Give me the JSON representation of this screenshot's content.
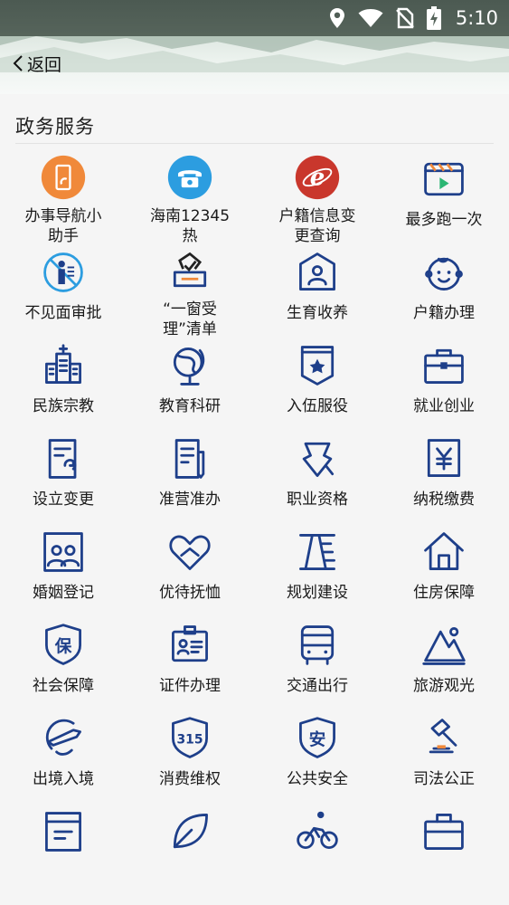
{
  "status_bar": {
    "time": "5:10",
    "icons": [
      "location-icon",
      "wifi-icon",
      "no-sim-icon",
      "battery-charging-icon"
    ]
  },
  "header": {
    "back_label": "返回"
  },
  "section": {
    "title": "政务服务"
  },
  "colors": {
    "icon_blue": "#1e3f8a",
    "orange": "#f0893a",
    "sky_blue": "#2c9de0",
    "red": "#c9372c"
  },
  "services": [
    {
      "label": "办事导航小助手",
      "icon": "phone-guide-icon"
    },
    {
      "label": "海南12345热",
      "icon": "telephone-icon"
    },
    {
      "label": "户籍信息变更查询",
      "icon": "browser-e-icon"
    },
    {
      "label": "最多跑一次",
      "icon": "video-play-icon"
    },
    {
      "label": "不见面审批",
      "icon": "no-person-icon"
    },
    {
      "label": "“一窗受理”清单",
      "icon": "ballot-box-icon"
    },
    {
      "label": "生育收养",
      "icon": "family-house-icon"
    },
    {
      "label": "户籍办理",
      "icon": "baby-face-icon"
    },
    {
      "label": "民族宗教",
      "icon": "church-icon"
    },
    {
      "label": "教育科研",
      "icon": "globe-icon"
    },
    {
      "label": "入伍服役",
      "icon": "military-badge-icon"
    },
    {
      "label": "就业创业",
      "icon": "briefcase-icon"
    },
    {
      "label": "设立变更",
      "icon": "document-refresh-icon"
    },
    {
      "label": "准营准办",
      "icon": "document-pen-icon"
    },
    {
      "label": "职业资格",
      "icon": "graduation-cap-icon"
    },
    {
      "label": "纳税缴费",
      "icon": "yuan-document-icon"
    },
    {
      "label": "婚姻登记",
      "icon": "couple-photo-icon"
    },
    {
      "label": "优待抚恤",
      "icon": "heart-hands-icon"
    },
    {
      "label": "规划建设",
      "icon": "road-planning-icon"
    },
    {
      "label": "住房保障",
      "icon": "house-icon"
    },
    {
      "label": "社会保障",
      "icon": "shield-bao-icon"
    },
    {
      "label": "证件办理",
      "icon": "id-card-icon"
    },
    {
      "label": "交通出行",
      "icon": "bus-icon"
    },
    {
      "label": "旅游观光",
      "icon": "mountain-icon"
    },
    {
      "label": "出境入境",
      "icon": "airplane-globe-icon"
    },
    {
      "label": "消费维权",
      "icon": "shield-315-icon"
    },
    {
      "label": "公共安全",
      "icon": "shield-an-icon"
    },
    {
      "label": "司法公正",
      "icon": "gavel-icon"
    },
    {
      "label": "",
      "icon": "archive-box-icon"
    },
    {
      "label": "",
      "icon": "leaf-icon"
    },
    {
      "label": "",
      "icon": "cyclist-icon"
    },
    {
      "label": "",
      "icon": "toolbox-icon"
    }
  ]
}
